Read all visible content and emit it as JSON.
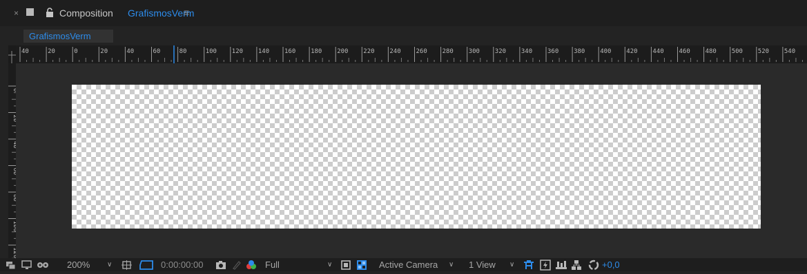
{
  "panel": {
    "title": "Composition",
    "comp_name": "GrafismosVerm",
    "close_symbol": "×",
    "menu_symbol": "≡",
    "icons": {
      "close": "close-icon",
      "swatch": "color-swatch",
      "lock": "lock-icon",
      "menu": "hamburger-menu-icon"
    }
  },
  "tabs": [
    {
      "label": "GrafismosVerm",
      "active": true
    }
  ],
  "rulers": {
    "top_labels": [
      "40",
      "20",
      "0",
      "20",
      "40",
      "60",
      "80",
      "100",
      "120",
      "140",
      "160",
      "180",
      "200",
      "220",
      "240",
      "260",
      "280",
      "300",
      "320",
      "340",
      "360",
      "380",
      "400",
      "420",
      "440",
      "460",
      "480",
      "500",
      "520",
      "540"
    ],
    "left_labels": [
      "0",
      "20",
      "40",
      "60",
      "80",
      "100",
      "120"
    ]
  },
  "viewer": {
    "background": "transparency-checkerboard"
  },
  "toolbar": {
    "zoom": "200%",
    "timecode": "0:00:00:00",
    "resolution": "Full",
    "camera": "Active Camera",
    "views": "1 View",
    "exposure": "+0,0",
    "icons": [
      "always-preview-icon",
      "monitor-icon",
      "mask-visibility-icon",
      "region-of-interest-icon",
      "grid-icon",
      "snapshot-icon",
      "show-snapshot-icon",
      "color-channels-icon",
      "transparency-grid-icon",
      "toggle-pixel-aspect-icon",
      "3d-renderer-icon",
      "fast-preview-icon",
      "timeline-icon",
      "flowchart-icon",
      "reset-exposure-icon"
    ]
  },
  "colors": {
    "accent": "#2d8ceb",
    "panel_bg": "#232323",
    "header_bg": "#1e1e1e"
  }
}
